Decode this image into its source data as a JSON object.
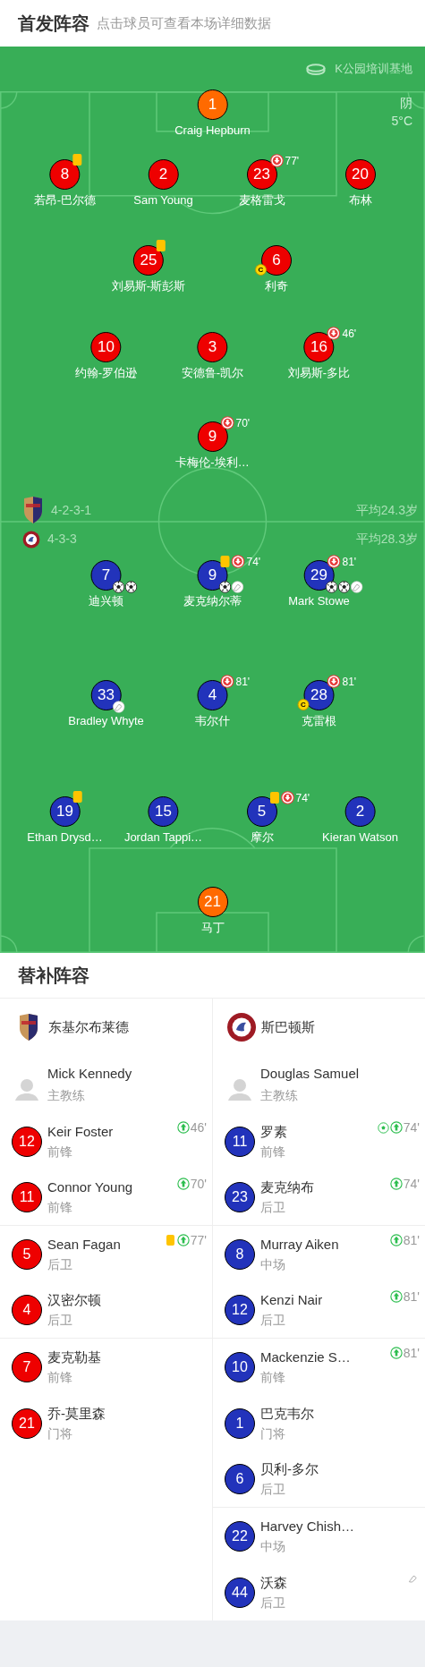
{
  "header": {
    "title": "首发阵容",
    "subtitle": "点击球员可查看本场详细数据"
  },
  "venue": "K公园培训基地",
  "weather": {
    "condition": "阴",
    "temperature": "5°C"
  },
  "home": {
    "color": "#ee0000",
    "formation": "4-2-3-1",
    "average_age": "平均24.3岁",
    "lines": [
      [
        {
          "number": "1",
          "name": "Craig Hepburn",
          "kind": "goalkeeper",
          "yellow_card": false
        }
      ],
      [
        {
          "number": "8",
          "name": "若昂-巴尔德",
          "kind": "outfield",
          "yellow_card": true
        },
        {
          "number": "2",
          "name": "Sam Young",
          "kind": "outfield",
          "yellow_card": false
        },
        {
          "number": "23",
          "name": "麦格雷戈",
          "kind": "outfield",
          "yellow_card": false,
          "sub_out": "77'"
        },
        {
          "number": "20",
          "name": "布林",
          "kind": "outfield",
          "yellow_card": false
        }
      ],
      [
        {
          "number": "25",
          "name": "刘易斯-斯彭斯",
          "kind": "outfield",
          "yellow_card": true
        },
        {
          "number": "6",
          "name": "利奇",
          "kind": "outfield",
          "yellow_card": false,
          "captain": "C"
        }
      ],
      [
        {
          "number": "10",
          "name": "约翰-罗伯逊",
          "kind": "outfield",
          "yellow_card": false
        },
        {
          "number": "3",
          "name": "安德鲁-凯尔",
          "kind": "outfield",
          "yellow_card": false
        },
        {
          "number": "16",
          "name": "刘易斯-多比",
          "kind": "outfield",
          "yellow_card": false,
          "sub_out": "46'"
        }
      ],
      [
        {
          "number": "9",
          "name": "卡梅伦-埃利…",
          "kind": "outfield",
          "yellow_card": false,
          "sub_out": "70'"
        }
      ]
    ]
  },
  "away": {
    "color": "#2233bb",
    "formation": "4-3-3",
    "average_age": "平均28.3岁",
    "lines": [
      [
        {
          "number": "7",
          "name": "迪兴顿",
          "kind": "outfield",
          "yellow_card": false,
          "events": [
            {
              "kind": "goal"
            },
            {
              "kind": "goal"
            }
          ]
        },
        {
          "number": "9",
          "name": "麦克纳尔蒂",
          "kind": "outfield",
          "yellow_card": true,
          "sub_out": "74'",
          "events": [
            {
              "kind": "goal"
            },
            {
              "kind": "assist"
            }
          ]
        },
        {
          "number": "29",
          "name": "Mark Stowe",
          "kind": "outfield",
          "yellow_card": false,
          "sub_out": "81'",
          "events": [
            {
              "kind": "goal"
            },
            {
              "kind": "goal"
            },
            {
              "kind": "assist"
            }
          ]
        }
      ],
      [
        {
          "number": "33",
          "name": "Bradley Whyte",
          "kind": "outfield",
          "yellow_card": false,
          "events": [
            {
              "kind": "assist"
            }
          ]
        },
        {
          "number": "4",
          "name": "韦尔什",
          "kind": "outfield",
          "yellow_card": false,
          "sub_out": "81'"
        },
        {
          "number": "28",
          "name": "克雷根",
          "kind": "outfield",
          "yellow_card": false,
          "sub_out": "81'",
          "captain": "C"
        }
      ],
      [
        {
          "number": "19",
          "name": "Ethan Drysd…",
          "kind": "outfield",
          "yellow_card": true
        },
        {
          "number": "15",
          "name": "Jordan Tappi…",
          "kind": "outfield",
          "yellow_card": false
        },
        {
          "number": "5",
          "name": "摩尔",
          "kind": "outfield",
          "yellow_card": true,
          "sub_out": "74'"
        },
        {
          "number": "2",
          "name": "Kieran Watson",
          "kind": "outfield",
          "yellow_card": false
        }
      ],
      [
        {
          "number": "21",
          "name": "马丁",
          "kind": "goalkeeper",
          "yellow_card": false
        }
      ]
    ]
  },
  "substitutes": {
    "title": "替补阵容",
    "teams": [
      {
        "name": "东基尔布莱德",
        "coach": {
          "name": "Mick Kennedy",
          "role": "主教练"
        },
        "players": [
          {
            "number": "12",
            "name": "Keir Foster",
            "position": "前锋",
            "yellow_card": false,
            "sub_in": "46'"
          },
          {
            "number": "11",
            "name": "Connor Young",
            "position": "前锋",
            "yellow_card": false,
            "sub_in": "70'"
          },
          {
            "number": "5",
            "name": "Sean Fagan",
            "position": "后卫",
            "yellow_card": true,
            "sub_in": "77'"
          },
          {
            "number": "4",
            "name": "汉密尔顿",
            "position": "后卫",
            "yellow_card": false
          },
          {
            "number": "7",
            "name": "麦克勒基",
            "position": "前锋",
            "yellow_card": false
          },
          {
            "number": "21",
            "name": "乔-莫里森",
            "position": "门将",
            "yellow_card": false
          }
        ]
      },
      {
        "name": "斯巴顿斯",
        "coach": {
          "name": "Douglas Samuel",
          "role": "主教练"
        },
        "players": [
          {
            "number": "11",
            "name": "罗素",
            "position": "前锋",
            "yellow_card": false,
            "sub_in": "74'",
            "events": [
              {
                "kind": "goal"
              }
            ]
          },
          {
            "number": "23",
            "name": "麦克纳布",
            "position": "后卫",
            "yellow_card": false,
            "sub_in": "74'"
          },
          {
            "number": "8",
            "name": "Murray Aiken",
            "position": "中场",
            "yellow_card": false,
            "sub_in": "81'"
          },
          {
            "number": "12",
            "name": "Kenzi Nair",
            "position": "后卫",
            "yellow_card": false,
            "sub_in": "81'"
          },
          {
            "number": "10",
            "name": "Mackenzie S…",
            "position": "前锋",
            "yellow_card": false,
            "sub_in": "81'"
          },
          {
            "number": "1",
            "name": "巴克韦尔",
            "position": "门将",
            "yellow_card": false
          },
          {
            "number": "6",
            "name": "贝利-多尔",
            "position": "后卫",
            "yellow_card": false
          },
          {
            "number": "22",
            "name": "Harvey Chish…",
            "position": "中场",
            "yellow_card": false
          },
          {
            "number": "44",
            "name": "沃森",
            "position": "后卫",
            "yellow_card": false,
            "events": [
              {
                "kind": "assist"
              }
            ]
          }
        ]
      }
    ]
  }
}
